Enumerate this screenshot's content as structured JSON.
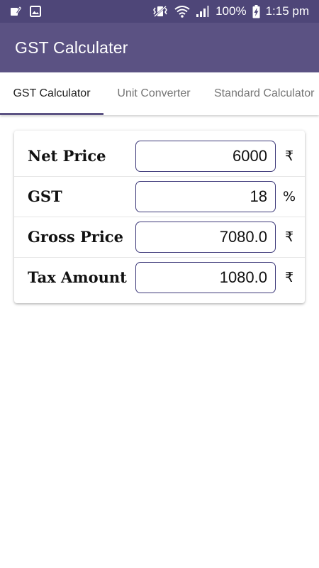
{
  "status_bar": {
    "icons_left": [
      "edit-notification-icon",
      "image-notification-icon"
    ],
    "icons_right": [
      "vibrate-icon",
      "wifi-icon",
      "signal-icon",
      "battery-charging-icon"
    ],
    "battery": "100%",
    "time": "1:15 pm"
  },
  "app_bar": {
    "title": "GST Calculater"
  },
  "tabs": [
    {
      "label": "GST Calculator",
      "active": true
    },
    {
      "label": "Unit Converter",
      "active": false
    },
    {
      "label": "Standard Calculator",
      "active": false
    }
  ],
  "rows": [
    {
      "label": "Net Price",
      "value": "6000",
      "unit": "₹"
    },
    {
      "label": "GST",
      "value": "18",
      "unit": "%"
    },
    {
      "label": "Gross Price",
      "value": "7080.0",
      "unit": "₹"
    },
    {
      "label": "Tax Amount",
      "value": "1080.0",
      "unit": "₹"
    }
  ],
  "colors": {
    "status_bar": "#4e4678",
    "app_bar": "#5b5283",
    "tab_indicator": "#5b5283",
    "input_border": "#3e3a7a"
  }
}
